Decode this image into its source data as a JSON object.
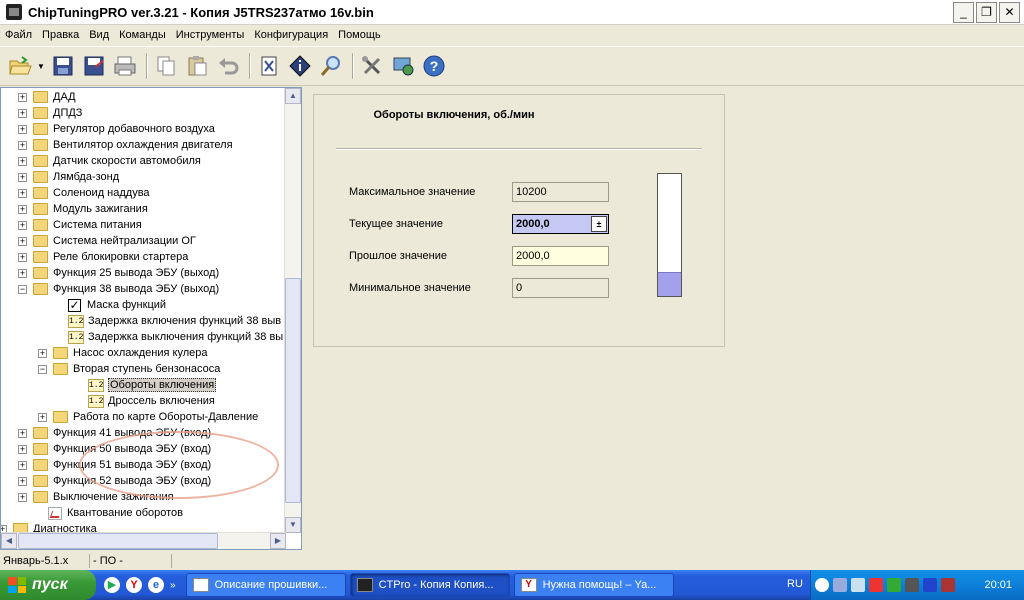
{
  "window": {
    "title": "ChipTuningPRO ver.3.21 - Копия J5TRS237атмо 16v.bin",
    "minimize": "_",
    "restore": "❐",
    "close": "✕"
  },
  "menu": [
    "Файл",
    "Правка",
    "Вид",
    "Команды",
    "Инструменты",
    "Конфигурация",
    "Помощь"
  ],
  "tree": {
    "items": [
      {
        "label": "ДАД"
      },
      {
        "label": "ДПДЗ"
      },
      {
        "label": "Регулятор добавочного воздуха"
      },
      {
        "label": "Вентилятор охлаждения двигателя"
      },
      {
        "label": "Датчик скорости автомобиля"
      },
      {
        "label": "Лямбда-зонд"
      },
      {
        "label": "Соленоид наддува"
      },
      {
        "label": "Модуль зажигания"
      },
      {
        "label": "Система питания"
      },
      {
        "label": "Система нейтрализации ОГ"
      },
      {
        "label": "Реле блокировки стартера"
      },
      {
        "label": "Функция 25 вывода ЭБУ (выход)"
      },
      {
        "label": "Функция 38 вывода ЭБУ (выход)"
      },
      {
        "label": "Маска функций"
      },
      {
        "label": "Задержка включения функций 38 выв"
      },
      {
        "label": "Задержка выключения функций 38 выв"
      },
      {
        "label": "Насос охлаждения кулера"
      },
      {
        "label": "Вторая ступень бензонасоса"
      },
      {
        "label": "Обороты включения"
      },
      {
        "label": "Дроссель включения"
      },
      {
        "label": "Работа по карте Обороты-Давление"
      },
      {
        "label": "Функция 41 вывода ЭБУ (вход)"
      },
      {
        "label": "Функция 50 вывода ЭБУ (вход)"
      },
      {
        "label": "Функция 51 вывода ЭБУ (вход)"
      },
      {
        "label": "Функция 52 вывода ЭБУ (вход)"
      },
      {
        "label": "Выключение зажигания"
      },
      {
        "label": "Квантование оборотов"
      },
      {
        "label": "Диагностика"
      }
    ],
    "num_icon_text": "1.2",
    "plus": "+",
    "minus": "−"
  },
  "param": {
    "title": "Обороты включения, об./мин",
    "max_label": "Максимальное значение",
    "max_value": "10200",
    "current_label": "Текущее значение",
    "current_value": "2000,0",
    "previous_label": "Прошлое значение",
    "previous_value": "2000,0",
    "min_label": "Минимальное значение",
    "min_value": "0",
    "gauge_level": 0.2
  },
  "status": {
    "cell1": "Январь-5.1.x",
    "cell2": "- ПО -"
  },
  "taskbar": {
    "start": "пуск",
    "tasks": [
      "Описание прошивки...",
      "CTPro - Копия Копия...",
      "Нужна помощь! – Ya..."
    ],
    "lang": "RU",
    "clock": "20:01"
  },
  "colors": {
    "current_field": "#c4c8f3",
    "previous_field": "#ffffe0",
    "gauge_fill": "#a3a1ec",
    "taskbar": "#245edc",
    "start": "#3a9a37"
  }
}
